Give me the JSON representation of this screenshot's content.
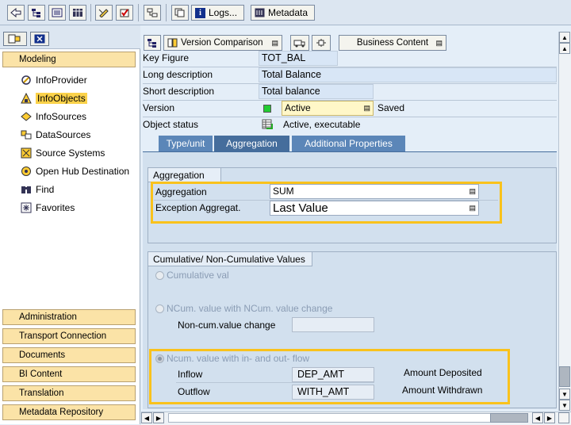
{
  "toolbar": {
    "logs_label": "Logs...",
    "metadata_label": "Metadata"
  },
  "nav": {
    "items": [
      {
        "label": "InfoProvider",
        "icon": "infoprovider-icon"
      },
      {
        "label": "InfoObjects",
        "icon": "infoobjects-icon",
        "selected": true
      },
      {
        "label": "InfoSources",
        "icon": "infosources-icon"
      },
      {
        "label": "DataSources",
        "icon": "datasources-icon"
      },
      {
        "label": "Source Systems",
        "icon": "source-systems-icon"
      },
      {
        "label": "Open Hub Destination",
        "icon": "open-hub-icon"
      },
      {
        "label": "Find",
        "icon": "binoculars-icon"
      },
      {
        "label": "Favorites",
        "icon": "favorites-icon"
      }
    ],
    "modeling": "Modeling",
    "sections": [
      "Administration",
      "Transport Connection",
      "Documents",
      "BI Content",
      "Translation",
      "Metadata Repository"
    ]
  },
  "header_buttons": {
    "version_comparison": "Version Comparison",
    "business_content": "Business Content"
  },
  "form": {
    "key_figure_label": "Key Figure",
    "key_figure_value": "TOT_BAL",
    "long_desc_label": "Long description",
    "long_desc_value": "Total Balance",
    "short_desc_label": "Short description",
    "short_desc_value": "Total balance",
    "version_label": "Version",
    "version_value": "Active",
    "version_saved": "Saved",
    "status_label": "Object status",
    "status_value": "Active, executable"
  },
  "tabs": [
    "Type/unit",
    "Aggregation",
    "Additional Properties"
  ],
  "aggregation": {
    "group_title": "Aggregation",
    "agg_label": "Aggregation",
    "agg_value": "SUM",
    "exc_label": "Exception Aggregat.",
    "exc_value": "Last Value"
  },
  "cumulative": {
    "group_title": "Cumulative/ Non-Cumulative Values",
    "opt1": "Cumulative val",
    "opt2": "NCum. value with NCum. value change",
    "noncum_change_label": "Non-cum.value change",
    "noncum_change_value": "",
    "opt3": "Ncum. value with in- and out- flow",
    "inflow_label": "Inflow",
    "inflow_value": "DEP_AMT",
    "inflow_desc": "Amount Deposited",
    "outflow_label": "Outflow",
    "outflow_value": "WITH_AMT",
    "outflow_desc": "Amount Withdrawn"
  },
  "colors": {
    "highlight": "#f9c21c",
    "tab_bg": "#5b86b8",
    "nav_selected": "#fbd24a",
    "status_green": "#22cc33"
  }
}
